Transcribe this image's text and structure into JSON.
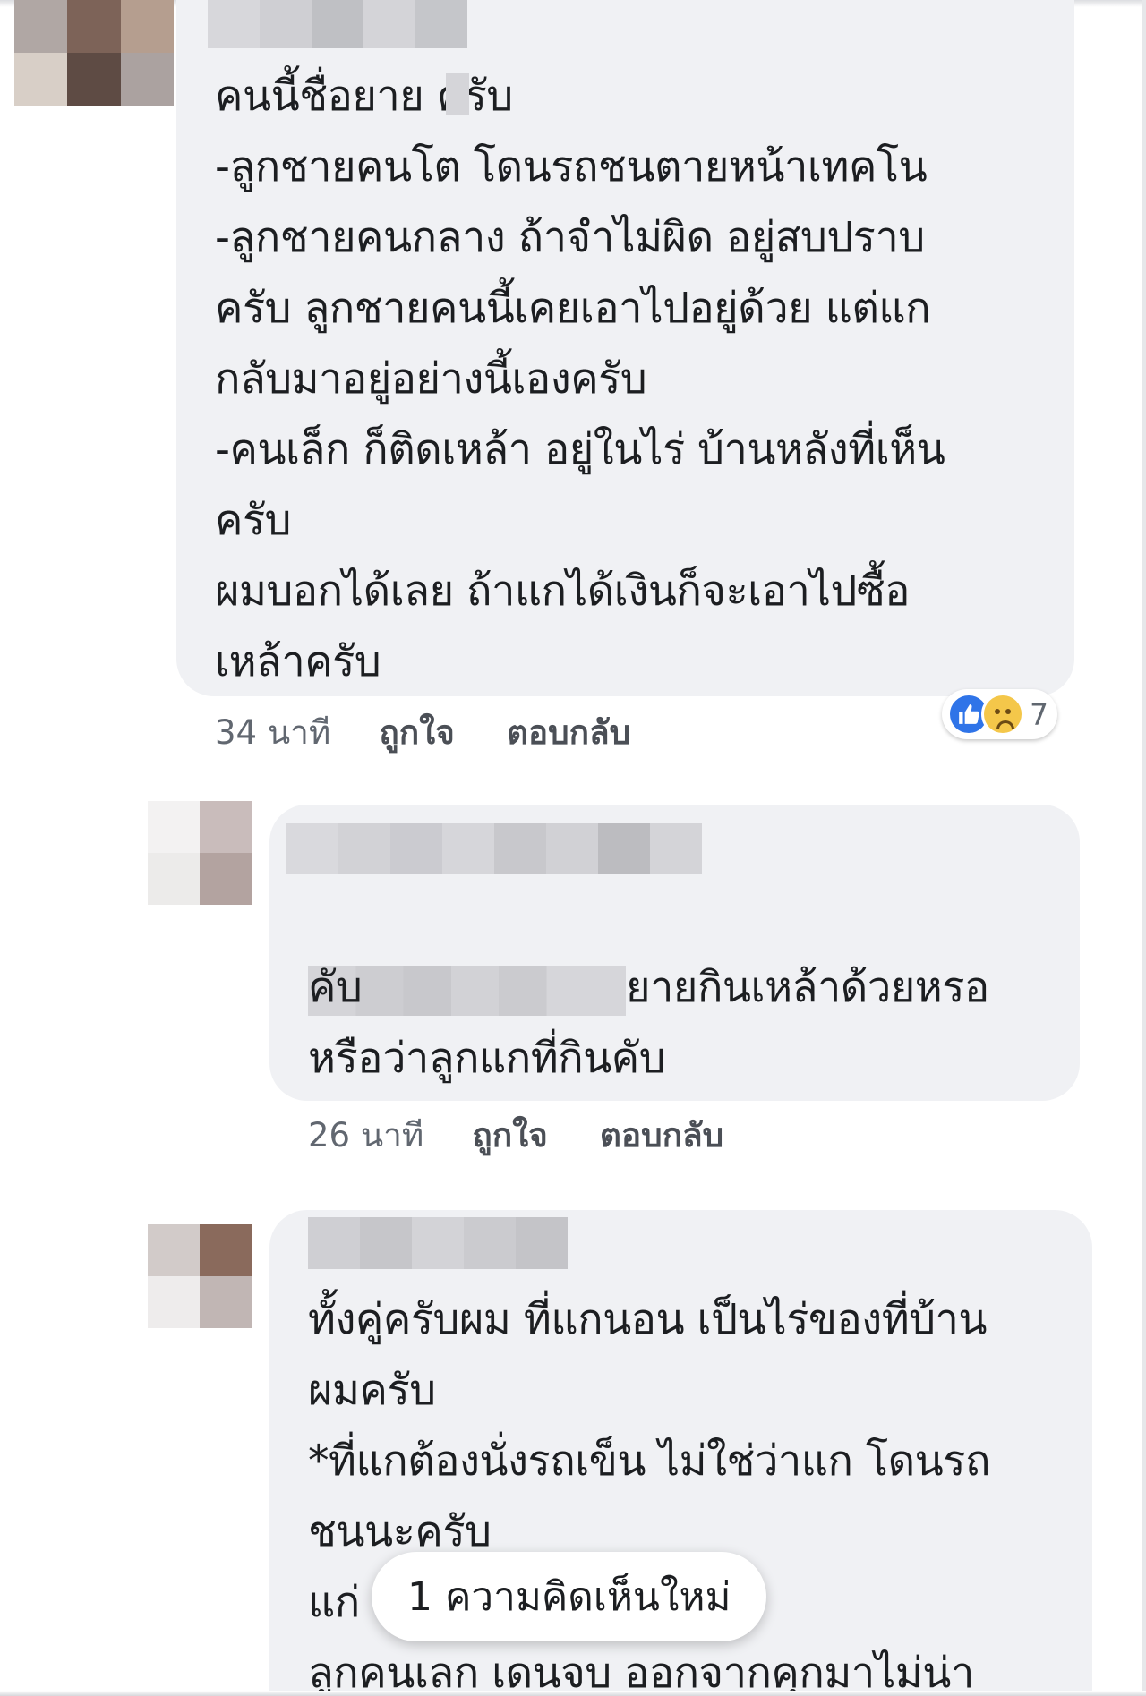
{
  "comments": [
    {
      "text": "คนนี้ชื่อยาย  ครับ\n-ลูกชายคนโต โดนรถชนตายหน้าเทคโน\n-ลูกชายคนกลาง ถ้าจำไม่ผิด อยู่สบปราบ\nครับ ลูกชายคนนี้เคยเอาไปอยู่ด้วย แต่แก\nกลับมาอยู่อย่างนี้เองครับ\n-คนเล็ก ก็ติดเหล้า อยู่ในไร่ บ้านหลังที่เห็น\nครับ\nผมบอกได้เลย ถ้าแกได้เงินก็จะเอาไปซื้อ\nเหล้าครับ",
      "time": "34 นาที",
      "like_label": "ถูกใจ",
      "reply_label": "ตอบกลับ",
      "reaction_count": "7",
      "reaction_icons": [
        "like-icon",
        "sad-icon"
      ]
    },
    {
      "text_after_mention": "ยายกินเหล้าด้วยหรอ",
      "text_rest": "คับ\nหรือว่าลูกแกที่กินคับ",
      "time": "26 นาที",
      "like_label": "ถูกใจ",
      "reply_label": "ตอบกลับ"
    },
    {
      "text": "ทั้งคู่ครับผม ที่แกนอน เป็นไร่ของที่บ้าน\nผมครับ\n*ที่แกต้องนั่งรถเข็น ไม่ใช่ว่าแก โดนรถ\nชนนะครับ\nแก่                                    บตอนเมา แล้ว\nลูกคนเลก เดนจบ ออกจากคุกมาไม่น่า"
    }
  ],
  "new_comments_pill": "1 ความคิดเห็นใหม่",
  "colors": {
    "bubble": "#f0f1f4",
    "meta_text": "#606770",
    "like_blue": "#2f74e8"
  }
}
